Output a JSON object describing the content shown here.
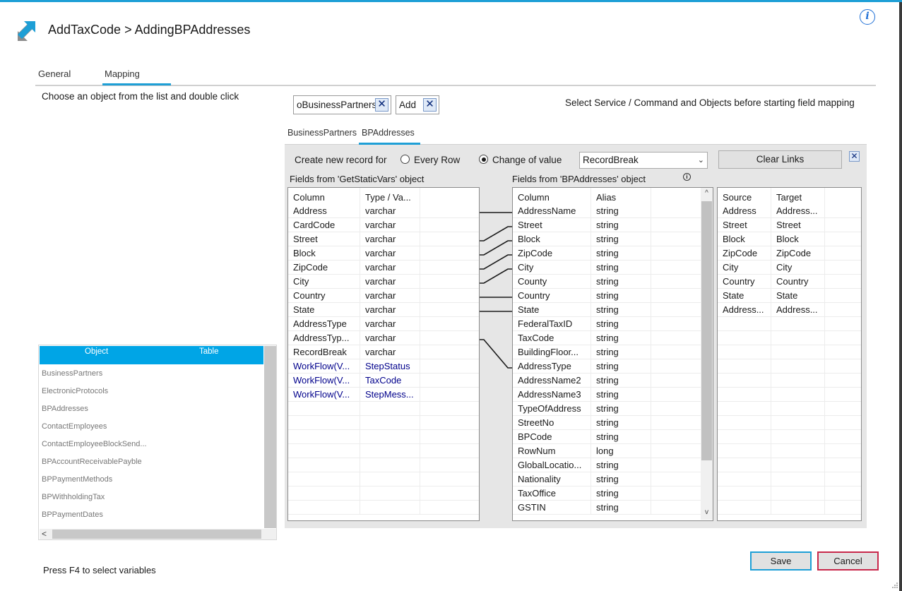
{
  "window": {
    "title": "AddTaxCode > AddingBPAddresses",
    "info_icon": "i"
  },
  "tabs": [
    {
      "label": "General",
      "active": false
    },
    {
      "label": "Mapping",
      "active": true
    }
  ],
  "object_picker": {
    "instruction": "Choose an object from the list and double click",
    "headers": {
      "object": "Object",
      "table": "Table"
    },
    "items": [
      "BusinessPartners",
      "ElectronicProtocols",
      "BPAddresses",
      "ContactEmployees",
      "ContactEmployeeBlockSend...",
      "BPAccountReceivablePayble",
      "BPPaymentMethods",
      "BPWithholdingTax",
      "BPPaymentDates"
    ],
    "scroll_left": "<"
  },
  "selection": {
    "chips": [
      {
        "label": "oBusinessPartners",
        "remove": "✕"
      },
      {
        "label": "Add",
        "remove": "✕"
      }
    ],
    "hint": "Select Service / Command and Objects before starting field mapping"
  },
  "sub_tabs": [
    {
      "label": "BusinessPartners",
      "active": false
    },
    {
      "label": "BPAddresses",
      "active": true
    }
  ],
  "options": {
    "create_label": "Create new record for",
    "every_row": "Every Row",
    "change_of_value": "Change of value",
    "selected_mode": "change_of_value",
    "record_field": "RecordBreak",
    "clear_links": "Clear Links",
    "close": "✕"
  },
  "source_grid": {
    "title": "Fields from 'GetStaticVars' object",
    "headers": [
      "Column",
      "Type / Va..."
    ],
    "rows": [
      {
        "column": "Address",
        "type": "varchar",
        "variable": false
      },
      {
        "column": "CardCode",
        "type": "varchar",
        "variable": false
      },
      {
        "column": "Street",
        "type": "varchar",
        "variable": false
      },
      {
        "column": "Block",
        "type": "varchar",
        "variable": false
      },
      {
        "column": "ZipCode",
        "type": "varchar",
        "variable": false
      },
      {
        "column": "City",
        "type": "varchar",
        "variable": false
      },
      {
        "column": "Country",
        "type": "varchar",
        "variable": false
      },
      {
        "column": "State",
        "type": "varchar",
        "variable": false
      },
      {
        "column": "AddressType",
        "type": "varchar",
        "variable": false
      },
      {
        "column": "AddressTyp...",
        "type": "varchar",
        "variable": false
      },
      {
        "column": "RecordBreak",
        "type": "varchar",
        "variable": false
      },
      {
        "column": "WorkFlow(V...",
        "type": "StepStatus",
        "variable": true
      },
      {
        "column": "WorkFlow(V...",
        "type": "TaxCode",
        "variable": true
      },
      {
        "column": "WorkFlow(V...",
        "type": "StepMess...",
        "variable": true
      },
      {
        "column": "",
        "type": "",
        "variable": false
      },
      {
        "column": "",
        "type": "",
        "variable": false
      },
      {
        "column": "",
        "type": "",
        "variable": false
      },
      {
        "column": "",
        "type": "",
        "variable": false
      },
      {
        "column": "",
        "type": "",
        "variable": false
      },
      {
        "column": "",
        "type": "",
        "variable": false
      },
      {
        "column": "",
        "type": "",
        "variable": false
      },
      {
        "column": "",
        "type": "",
        "variable": false
      }
    ]
  },
  "target_grid": {
    "title": "Fields from 'BPAddresses' object",
    "headers": [
      "Column",
      "Alias"
    ],
    "rows": [
      {
        "column": "AddressName",
        "alias": "string"
      },
      {
        "column": "Street",
        "alias": "string"
      },
      {
        "column": "Block",
        "alias": "string"
      },
      {
        "column": "ZipCode",
        "alias": "string"
      },
      {
        "column": "City",
        "alias": "string"
      },
      {
        "column": "County",
        "alias": "string"
      },
      {
        "column": "Country",
        "alias": "string"
      },
      {
        "column": "State",
        "alias": "string"
      },
      {
        "column": "FederalTaxID",
        "alias": "string"
      },
      {
        "column": "TaxCode",
        "alias": "string"
      },
      {
        "column": "BuildingFloor...",
        "alias": "string"
      },
      {
        "column": "AddressType",
        "alias": "string"
      },
      {
        "column": "AddressName2",
        "alias": "string"
      },
      {
        "column": "AddressName3",
        "alias": "string"
      },
      {
        "column": "TypeOfAddress",
        "alias": "string"
      },
      {
        "column": "StreetNo",
        "alias": "string"
      },
      {
        "column": "BPCode",
        "alias": "string"
      },
      {
        "column": "RowNum",
        "alias": "long"
      },
      {
        "column": "GlobalLocatio...",
        "alias": "string"
      },
      {
        "column": "Nationality",
        "alias": "string"
      },
      {
        "column": "TaxOffice",
        "alias": "string"
      },
      {
        "column": "GSTIN",
        "alias": "string"
      }
    ],
    "scroll_up": "^",
    "scroll_down": "v"
  },
  "links_grid": {
    "headers": [
      "Source",
      "Target"
    ],
    "rows": [
      {
        "source": "Address",
        "target": "Address..."
      },
      {
        "source": "Street",
        "target": "Street"
      },
      {
        "source": "Block",
        "target": "Block"
      },
      {
        "source": "ZipCode",
        "target": "ZipCode"
      },
      {
        "source": "City",
        "target": "City"
      },
      {
        "source": "Country",
        "target": "Country"
      },
      {
        "source": "State",
        "target": "State"
      },
      {
        "source": "Address...",
        "target": "Address..."
      },
      {
        "source": "",
        "target": ""
      },
      {
        "source": "",
        "target": ""
      },
      {
        "source": "",
        "target": ""
      },
      {
        "source": "",
        "target": ""
      },
      {
        "source": "",
        "target": ""
      },
      {
        "source": "",
        "target": ""
      },
      {
        "source": "",
        "target": ""
      },
      {
        "source": "",
        "target": ""
      },
      {
        "source": "",
        "target": ""
      },
      {
        "source": "",
        "target": ""
      },
      {
        "source": "",
        "target": ""
      },
      {
        "source": "",
        "target": ""
      },
      {
        "source": "",
        "target": ""
      },
      {
        "source": "",
        "target": ""
      }
    ]
  },
  "connections": [
    {
      "from": 0,
      "to": 0
    },
    {
      "from": 2,
      "to": 1
    },
    {
      "from": 3,
      "to": 2
    },
    {
      "from": 4,
      "to": 3
    },
    {
      "from": 5,
      "to": 4
    },
    {
      "from": 6,
      "to": 6
    },
    {
      "from": 7,
      "to": 7
    },
    {
      "from": 9,
      "to": 11
    }
  ],
  "footer": {
    "hint": "Press F4 to select variables",
    "save": "Save",
    "cancel": "Cancel"
  },
  "colors": {
    "accent": "#1e9fd6",
    "cancel_border": "#c8284b",
    "variable_text": "#00008b"
  }
}
